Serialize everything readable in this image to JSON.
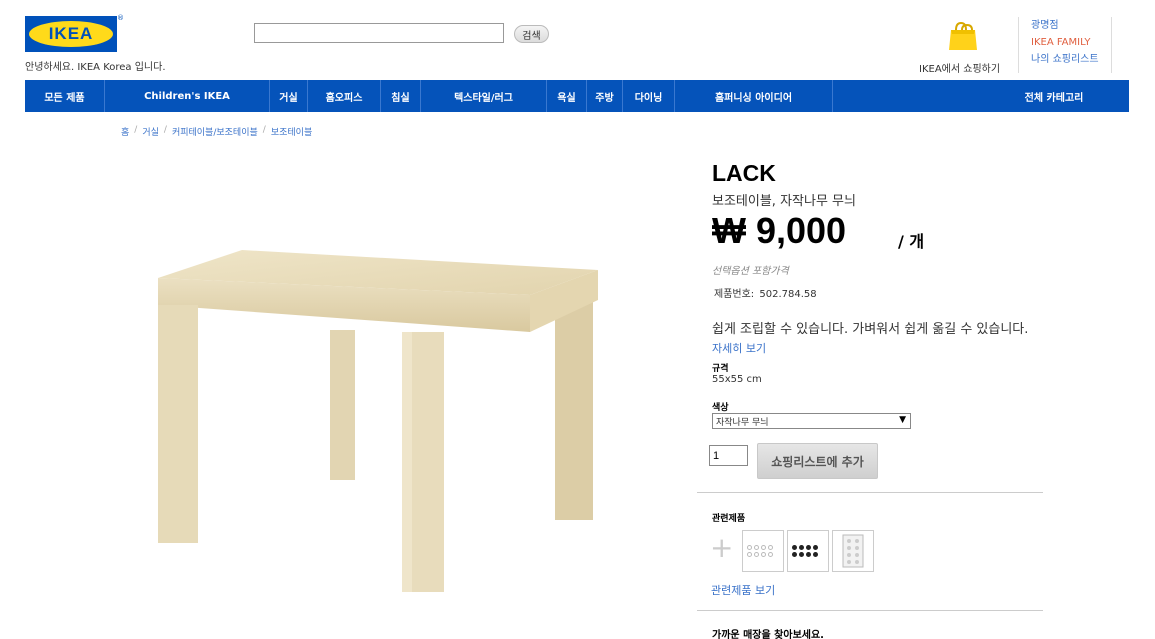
{
  "header": {
    "logo_text": "IKEA",
    "greeting": "안녕하세요. IKEA Korea 입니다.",
    "search_placeholder": "",
    "search_button": "검색",
    "shopping_label": "IKEA에서 쇼핑하기",
    "links": {
      "store": "광명점",
      "family": "IKEA FAMILY",
      "shopping_list": "나의 쇼핑리스트"
    }
  },
  "nav": {
    "items": [
      "모든 제품",
      "Children's IKEA",
      "거실",
      "홈오피스",
      "침실",
      "텍스타일/러그",
      "욕실",
      "주방",
      "다이닝",
      "홈퍼니싱 아이디어",
      "전체 카테고리"
    ]
  },
  "breadcrumb": [
    "홈",
    "거실",
    "커피테이블/보조테이블",
    "보조테이블"
  ],
  "product": {
    "name": "LACK",
    "description": "보조테이블, 자작나무 무늬",
    "price": "₩ 9,000",
    "unit": "/ 개",
    "price_note": "선택옵션 포함가격",
    "article_label": "제품번호:",
    "article_number": "502.784.58",
    "benefit_text": "쉽게 조립할 수 있습니다. 가벼워서 쉽게 옮길 수 있습니다.",
    "more_link": "자세히 보기",
    "dimensions_label": "규격",
    "dimensions_value": "55x55 cm",
    "color_label": "색상",
    "color_value": "자작나무 무늬",
    "quantity": "1",
    "add_button": "쇼핑리스트에 추가"
  },
  "related": {
    "title": "관련제품",
    "link": "관련제품 보기"
  },
  "store_finder": {
    "title": "가까운 매장을 찾아보세요."
  },
  "colors": {
    "nav_blue": "#0553ba",
    "logo_yellow": "#ffda1a",
    "link_blue": "#3a72c9",
    "family_red": "#e06040",
    "wood": "#e8dcbc"
  }
}
